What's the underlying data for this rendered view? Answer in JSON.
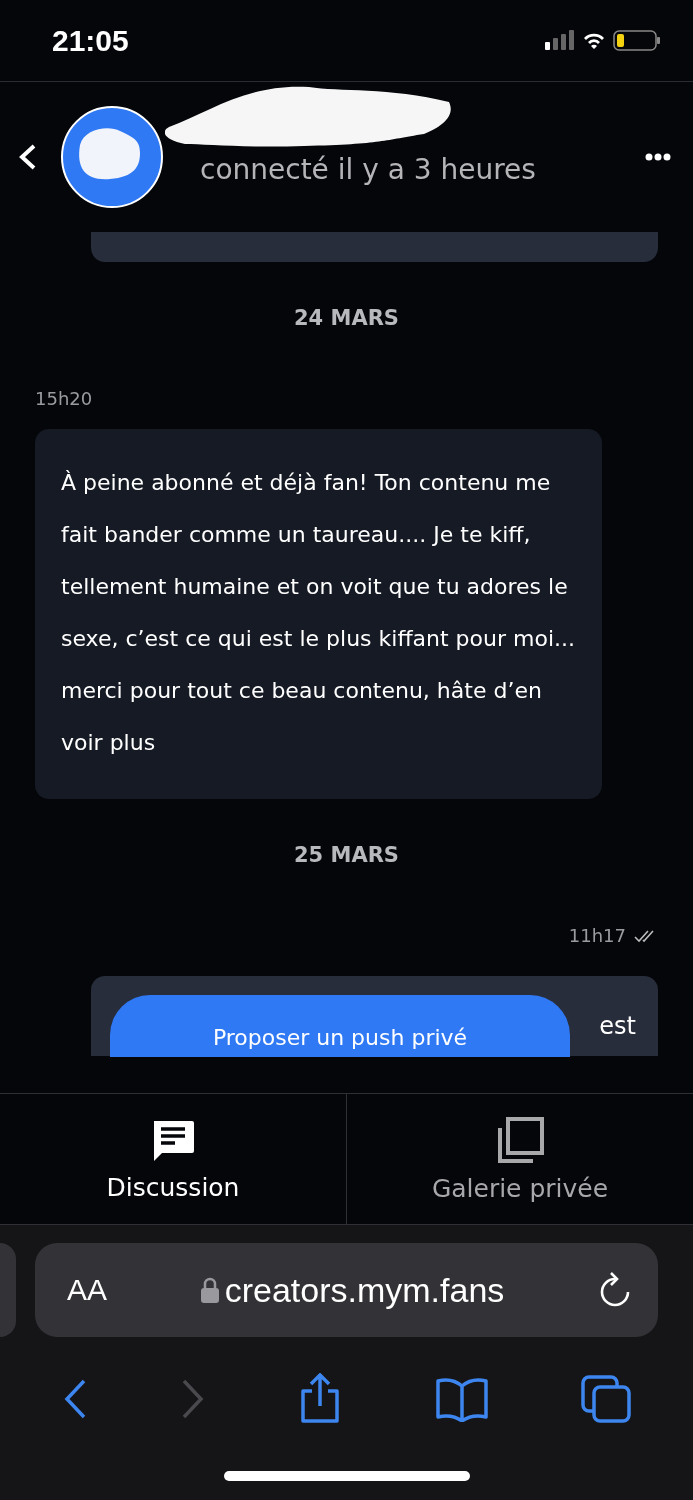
{
  "status_bar": {
    "time": "21:05"
  },
  "header": {
    "status": "connecté il y a 3 heures"
  },
  "messages": [
    {
      "kind": "date",
      "text": "24 MARS"
    },
    {
      "kind": "incoming_time",
      "text": "15h20"
    },
    {
      "kind": "incoming_bubble",
      "text": "À peine abonné et déjà fan! Ton contenu me fait bander comme un taureau.... Je te kiff, tellement humaine et on voit que tu adores le sexe, c’est ce qui est le plus kiffant pour moi... merci pour tout ce beau contenu, hâte d’en voir plus"
    },
    {
      "kind": "date",
      "text": "25 MARS"
    },
    {
      "kind": "outgoing_time",
      "text": "11h17",
      "read": true
    }
  ],
  "partial_bubble": {
    "text": "est",
    "button": "Proposer un push privé"
  },
  "tabs": [
    {
      "label": "Discussion",
      "selected": true
    },
    {
      "label": "Galerie privée",
      "selected": false
    }
  ],
  "browser": {
    "text_size": "AA",
    "url": "creators.mym.fans"
  }
}
